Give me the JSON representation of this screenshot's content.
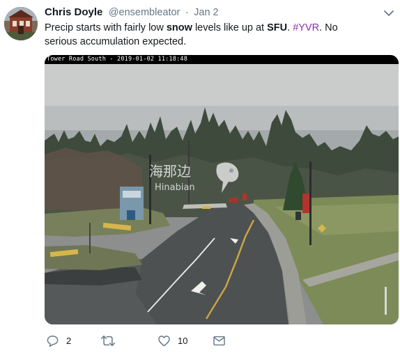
{
  "tweet": {
    "author_name": "Chris Doyle",
    "handle": "@ensembleator",
    "separator": "·",
    "date": "Jan 2",
    "text": {
      "part1": "Precip starts with fairly low ",
      "bold1": "snow",
      "part2": " levels like up at ",
      "bold2": "SFU",
      "part3": ". ",
      "hashtag": "#YVR",
      "part4": ". No serious accumulation expected."
    },
    "media": {
      "timestamp": "Tower Road South - 2019-01-02 11:18:48",
      "watermark_cn": "海那边",
      "watermark_en": "Hinabian"
    },
    "actions": {
      "reply_count": "2",
      "retweet_count": "",
      "like_count": "10"
    }
  },
  "icons": {
    "reply": "reply-icon",
    "retweet": "retweet-icon",
    "like": "heart-icon",
    "dm": "envelope-icon",
    "menu": "chevron-down-icon"
  },
  "colors": {
    "hashtag": "#8c2fa8",
    "muted": "#657786",
    "text": "#14171a"
  }
}
